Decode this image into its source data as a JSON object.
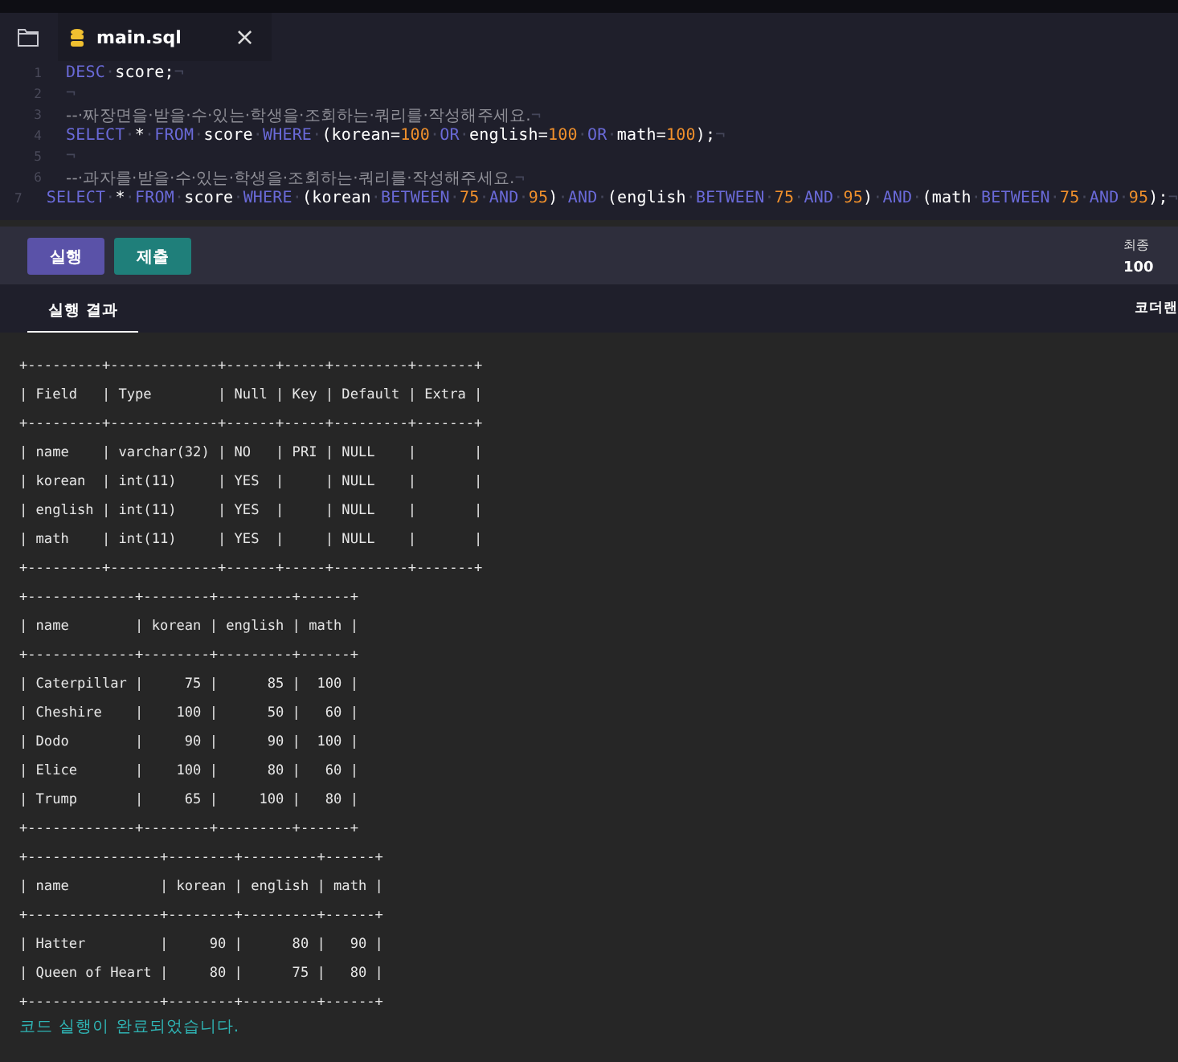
{
  "file_tab": {
    "title": "main.sql",
    "close": "×"
  },
  "code": [
    {
      "number": "1",
      "tokens": [
        {
          "kind": "kw",
          "text": "DESC"
        },
        {
          "kind": "ws",
          "text": "·"
        },
        {
          "kind": "id",
          "text": "score;"
        },
        {
          "kind": "ws",
          "text": "¬"
        }
      ]
    },
    {
      "number": "2",
      "tokens": [
        {
          "kind": "ws",
          "text": "¬"
        }
      ]
    },
    {
      "number": "3",
      "tokens": [
        {
          "kind": "cm",
          "text": "--·짜장면을·받을·수·있는·학생을·조회하는·쿼리를·작성해주세요."
        },
        {
          "kind": "ws",
          "text": "¬"
        }
      ]
    },
    {
      "number": "4",
      "tokens": [
        {
          "kind": "kw",
          "text": "SELECT"
        },
        {
          "kind": "ws",
          "text": "·"
        },
        {
          "kind": "id",
          "text": "*"
        },
        {
          "kind": "ws",
          "text": "·"
        },
        {
          "kind": "kw",
          "text": "FROM"
        },
        {
          "kind": "ws",
          "text": "·"
        },
        {
          "kind": "id",
          "text": "score"
        },
        {
          "kind": "ws",
          "text": "·"
        },
        {
          "kind": "kw",
          "text": "WHERE"
        },
        {
          "kind": "ws",
          "text": "·"
        },
        {
          "kind": "id",
          "text": "(korean="
        },
        {
          "kind": "nm",
          "text": "100"
        },
        {
          "kind": "ws",
          "text": "·"
        },
        {
          "kind": "kw",
          "text": "OR"
        },
        {
          "kind": "ws",
          "text": "·"
        },
        {
          "kind": "id",
          "text": "english="
        },
        {
          "kind": "nm",
          "text": "100"
        },
        {
          "kind": "ws",
          "text": "·"
        },
        {
          "kind": "kw",
          "text": "OR"
        },
        {
          "kind": "ws",
          "text": "·"
        },
        {
          "kind": "id",
          "text": "math="
        },
        {
          "kind": "nm",
          "text": "100"
        },
        {
          "kind": "id",
          "text": ");"
        },
        {
          "kind": "ws",
          "text": "¬"
        }
      ]
    },
    {
      "number": "5",
      "tokens": [
        {
          "kind": "ws",
          "text": "¬"
        }
      ]
    },
    {
      "number": "6",
      "tokens": [
        {
          "kind": "cm",
          "text": "--·과자를·받을·수·있는·학생을·조회하는·쿼리를·작성해주세요."
        },
        {
          "kind": "ws",
          "text": "¬"
        }
      ]
    },
    {
      "number": "7",
      "tokens": [
        {
          "kind": "kw",
          "text": "SELECT"
        },
        {
          "kind": "ws",
          "text": "·"
        },
        {
          "kind": "id",
          "text": "*"
        },
        {
          "kind": "ws",
          "text": "·"
        },
        {
          "kind": "kw",
          "text": "FROM"
        },
        {
          "kind": "ws",
          "text": "·"
        },
        {
          "kind": "id",
          "text": "score"
        },
        {
          "kind": "ws",
          "text": "·"
        },
        {
          "kind": "kw",
          "text": "WHERE"
        },
        {
          "kind": "ws",
          "text": "·"
        },
        {
          "kind": "id",
          "text": "(korean"
        },
        {
          "kind": "ws",
          "text": "·"
        },
        {
          "kind": "kw",
          "text": "BETWEEN"
        },
        {
          "kind": "ws",
          "text": "·"
        },
        {
          "kind": "nm",
          "text": "75"
        },
        {
          "kind": "ws",
          "text": "·"
        },
        {
          "kind": "kw",
          "text": "AND"
        },
        {
          "kind": "ws",
          "text": "·"
        },
        {
          "kind": "nm",
          "text": "95"
        },
        {
          "kind": "id",
          "text": ")"
        },
        {
          "kind": "ws",
          "text": "·"
        },
        {
          "kind": "kw",
          "text": "AND"
        },
        {
          "kind": "ws",
          "text": "·"
        },
        {
          "kind": "id",
          "text": "(english"
        },
        {
          "kind": "ws",
          "text": "·"
        },
        {
          "kind": "kw",
          "text": "BETWEEN"
        },
        {
          "kind": "ws",
          "text": "·"
        },
        {
          "kind": "nm",
          "text": "75"
        },
        {
          "kind": "ws",
          "text": "·"
        },
        {
          "kind": "kw",
          "text": "AND"
        },
        {
          "kind": "ws",
          "text": "·"
        },
        {
          "kind": "nm",
          "text": "95"
        },
        {
          "kind": "id",
          "text": ")"
        },
        {
          "kind": "ws",
          "text": "·"
        },
        {
          "kind": "kw",
          "text": "AND"
        },
        {
          "kind": "ws",
          "text": "·"
        },
        {
          "kind": "id",
          "text": "(math"
        },
        {
          "kind": "ws",
          "text": "·"
        },
        {
          "kind": "kw",
          "text": "BETWEEN"
        },
        {
          "kind": "ws",
          "text": "·"
        },
        {
          "kind": "nm",
          "text": "75"
        },
        {
          "kind": "ws",
          "text": "·"
        },
        {
          "kind": "kw",
          "text": "AND"
        },
        {
          "kind": "ws",
          "text": "·"
        },
        {
          "kind": "nm",
          "text": "95"
        },
        {
          "kind": "id",
          "text": ");"
        },
        {
          "kind": "ws",
          "text": "¬"
        }
      ]
    }
  ],
  "buttons": [
    {
      "kind": "run",
      "label": "실행"
    },
    {
      "kind": "submit",
      "label": "제출"
    }
  ],
  "score_panel": {
    "label": "최종",
    "value": "100"
  },
  "result_tabs": [
    {
      "label": "실행 결과",
      "selected": true
    },
    {
      "label": "코더랜",
      "selected": false
    }
  ],
  "output": [
    "+---------+-------------+------+-----+---------+-------+",
    "| Field   | Type        | Null | Key | Default | Extra |",
    "+---------+-------------+------+-----+---------+-------+",
    "| name    | varchar(32) | NO   | PRI | NULL    |       |",
    "| korean  | int(11)     | YES  |     | NULL    |       |",
    "| english | int(11)     | YES  |     | NULL    |       |",
    "| math    | int(11)     | YES  |     | NULL    |       |",
    "+---------+-------------+------+-----+---------+-------+",
    "+-------------+--------+---------+------+",
    "| name        | korean | english | math |",
    "+-------------+--------+---------+------+",
    "| Caterpillar |     75 |      85 |  100 |",
    "| Cheshire    |    100 |      50 |   60 |",
    "| Dodo        |     90 |      90 |  100 |",
    "| Elice       |    100 |      80 |   60 |",
    "| Trump       |     65 |     100 |   80 |",
    "+-------------+--------+---------+------+",
    "+----------------+--------+---------+------+",
    "| name           | korean | english | math |",
    "+----------------+--------+---------+------+",
    "| Hatter         |     90 |      80 |   90 |",
    "| Queen of Heart |     80 |      75 |   80 |",
    "+----------------+--------+---------+------+"
  ],
  "status": "코드 실행이 완료되었습니다."
}
